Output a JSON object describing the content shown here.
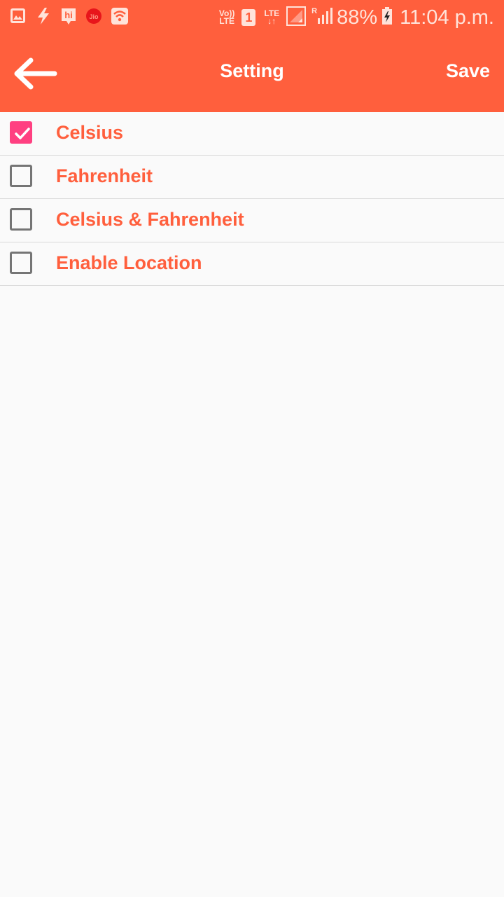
{
  "colors": {
    "primary": "#ff5f3d",
    "accent": "#ff4081",
    "text_on_primary": "#ffffff",
    "divider": "#d9d9d9",
    "background": "#fafafa"
  },
  "status_bar": {
    "left_icons": [
      "gallery-icon",
      "flash-icon",
      "hike-icon",
      "jio-icon",
      "wifi-icon"
    ],
    "hike_label": "hi",
    "jio_label": "Jio",
    "volte_line1": "Vo))",
    "volte_line2": "LTE",
    "sim_slot": "1",
    "lte_label": "LTE",
    "lte_arrows": "↓↑",
    "roaming_label": "R",
    "battery_percent": "88%",
    "time": "11:04 p.m."
  },
  "toolbar": {
    "title": "Setting",
    "save_label": "Save",
    "back_icon": "arrow-left-icon"
  },
  "options": [
    {
      "label": "Celsius",
      "checked": true
    },
    {
      "label": "Fahrenheit",
      "checked": false
    },
    {
      "label": "Celsius & Fahrenheit",
      "checked": false
    },
    {
      "label": "Enable Location",
      "checked": false
    }
  ]
}
